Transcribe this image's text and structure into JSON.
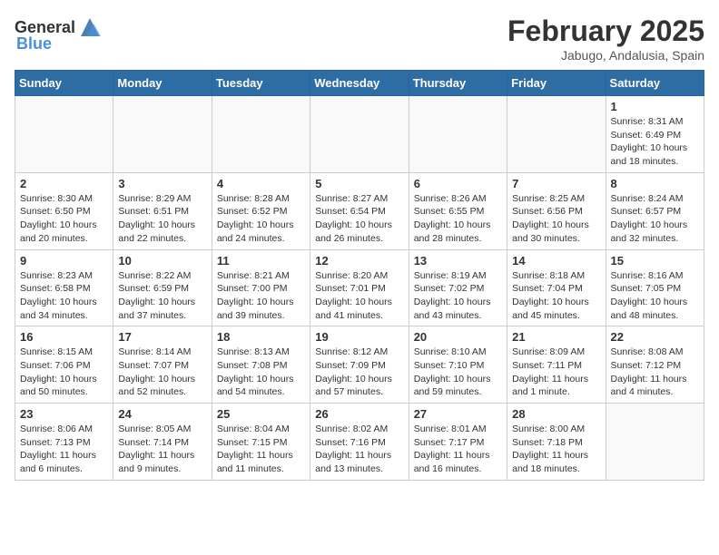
{
  "header": {
    "logo_general": "General",
    "logo_blue": "Blue",
    "month_year": "February 2025",
    "location": "Jabugo, Andalusia, Spain"
  },
  "weekdays": [
    "Sunday",
    "Monday",
    "Tuesday",
    "Wednesday",
    "Thursday",
    "Friday",
    "Saturday"
  ],
  "weeks": [
    [
      {
        "day": "",
        "info": ""
      },
      {
        "day": "",
        "info": ""
      },
      {
        "day": "",
        "info": ""
      },
      {
        "day": "",
        "info": ""
      },
      {
        "day": "",
        "info": ""
      },
      {
        "day": "",
        "info": ""
      },
      {
        "day": "1",
        "info": "Sunrise: 8:31 AM\nSunset: 6:49 PM\nDaylight: 10 hours\nand 18 minutes."
      }
    ],
    [
      {
        "day": "2",
        "info": "Sunrise: 8:30 AM\nSunset: 6:50 PM\nDaylight: 10 hours\nand 20 minutes."
      },
      {
        "day": "3",
        "info": "Sunrise: 8:29 AM\nSunset: 6:51 PM\nDaylight: 10 hours\nand 22 minutes."
      },
      {
        "day": "4",
        "info": "Sunrise: 8:28 AM\nSunset: 6:52 PM\nDaylight: 10 hours\nand 24 minutes."
      },
      {
        "day": "5",
        "info": "Sunrise: 8:27 AM\nSunset: 6:54 PM\nDaylight: 10 hours\nand 26 minutes."
      },
      {
        "day": "6",
        "info": "Sunrise: 8:26 AM\nSunset: 6:55 PM\nDaylight: 10 hours\nand 28 minutes."
      },
      {
        "day": "7",
        "info": "Sunrise: 8:25 AM\nSunset: 6:56 PM\nDaylight: 10 hours\nand 30 minutes."
      },
      {
        "day": "8",
        "info": "Sunrise: 8:24 AM\nSunset: 6:57 PM\nDaylight: 10 hours\nand 32 minutes."
      }
    ],
    [
      {
        "day": "9",
        "info": "Sunrise: 8:23 AM\nSunset: 6:58 PM\nDaylight: 10 hours\nand 34 minutes."
      },
      {
        "day": "10",
        "info": "Sunrise: 8:22 AM\nSunset: 6:59 PM\nDaylight: 10 hours\nand 37 minutes."
      },
      {
        "day": "11",
        "info": "Sunrise: 8:21 AM\nSunset: 7:00 PM\nDaylight: 10 hours\nand 39 minutes."
      },
      {
        "day": "12",
        "info": "Sunrise: 8:20 AM\nSunset: 7:01 PM\nDaylight: 10 hours\nand 41 minutes."
      },
      {
        "day": "13",
        "info": "Sunrise: 8:19 AM\nSunset: 7:02 PM\nDaylight: 10 hours\nand 43 minutes."
      },
      {
        "day": "14",
        "info": "Sunrise: 8:18 AM\nSunset: 7:04 PM\nDaylight: 10 hours\nand 45 minutes."
      },
      {
        "day": "15",
        "info": "Sunrise: 8:16 AM\nSunset: 7:05 PM\nDaylight: 10 hours\nand 48 minutes."
      }
    ],
    [
      {
        "day": "16",
        "info": "Sunrise: 8:15 AM\nSunset: 7:06 PM\nDaylight: 10 hours\nand 50 minutes."
      },
      {
        "day": "17",
        "info": "Sunrise: 8:14 AM\nSunset: 7:07 PM\nDaylight: 10 hours\nand 52 minutes."
      },
      {
        "day": "18",
        "info": "Sunrise: 8:13 AM\nSunset: 7:08 PM\nDaylight: 10 hours\nand 54 minutes."
      },
      {
        "day": "19",
        "info": "Sunrise: 8:12 AM\nSunset: 7:09 PM\nDaylight: 10 hours\nand 57 minutes."
      },
      {
        "day": "20",
        "info": "Sunrise: 8:10 AM\nSunset: 7:10 PM\nDaylight: 10 hours\nand 59 minutes."
      },
      {
        "day": "21",
        "info": "Sunrise: 8:09 AM\nSunset: 7:11 PM\nDaylight: 11 hours\nand 1 minute."
      },
      {
        "day": "22",
        "info": "Sunrise: 8:08 AM\nSunset: 7:12 PM\nDaylight: 11 hours\nand 4 minutes."
      }
    ],
    [
      {
        "day": "23",
        "info": "Sunrise: 8:06 AM\nSunset: 7:13 PM\nDaylight: 11 hours\nand 6 minutes."
      },
      {
        "day": "24",
        "info": "Sunrise: 8:05 AM\nSunset: 7:14 PM\nDaylight: 11 hours\nand 9 minutes."
      },
      {
        "day": "25",
        "info": "Sunrise: 8:04 AM\nSunset: 7:15 PM\nDaylight: 11 hours\nand 11 minutes."
      },
      {
        "day": "26",
        "info": "Sunrise: 8:02 AM\nSunset: 7:16 PM\nDaylight: 11 hours\nand 13 minutes."
      },
      {
        "day": "27",
        "info": "Sunrise: 8:01 AM\nSunset: 7:17 PM\nDaylight: 11 hours\nand 16 minutes."
      },
      {
        "day": "28",
        "info": "Sunrise: 8:00 AM\nSunset: 7:18 PM\nDaylight: 11 hours\nand 18 minutes."
      },
      {
        "day": "",
        "info": ""
      }
    ]
  ]
}
